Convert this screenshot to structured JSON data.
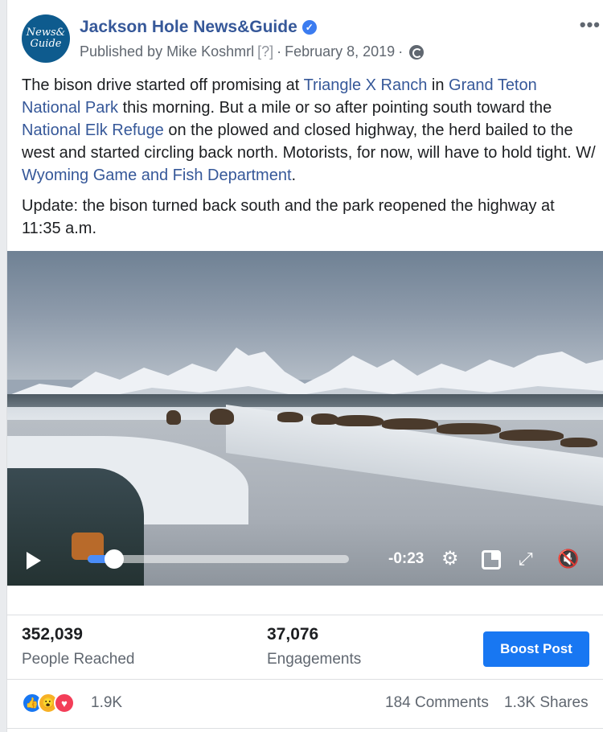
{
  "post": {
    "page_name": "Jackson Hole News&Guide",
    "avatar_line1": "News&",
    "avatar_line2": "Guide",
    "published_by": "Published by Mike Koshmrl",
    "help": "[?]",
    "sep": "·",
    "date": "February 8, 2019",
    "more": "•••"
  },
  "body": {
    "p1_a": "The bison drive started off promising at ",
    "link_ranch": "Triangle X Ranch",
    "p1_b": " in ",
    "link_park": "Grand Teton National Park",
    "p1_c": " this morning. But a mile or so after pointing south toward the ",
    "link_refuge": "National Elk Refuge",
    "p1_d": " on the plowed and closed highway, the herd bailed to the west and started circling back north. Motorists, for now, will have to hold tight. W/ ",
    "link_wgfd": "Wyoming Game and Fish Department",
    "p1_e": ".",
    "p2": "Update: the bison turned back south and the park reopened the highway at 11:35 a.m."
  },
  "video": {
    "time_remaining": "-0:23",
    "progress": 0.1
  },
  "stats": {
    "reached_num": "352,039",
    "reached_label": "People Reached",
    "engagements_num": "37,076",
    "engagements_label": "Engagements",
    "boost_label": "Boost Post"
  },
  "reactions": {
    "count": "1.9K",
    "comments": "184 Comments",
    "shares": "1.3K Shares",
    "icons": [
      "like-icon",
      "wow-icon",
      "love-icon"
    ]
  },
  "colors": {
    "link": "#365899",
    "boost": "#1877f2"
  }
}
